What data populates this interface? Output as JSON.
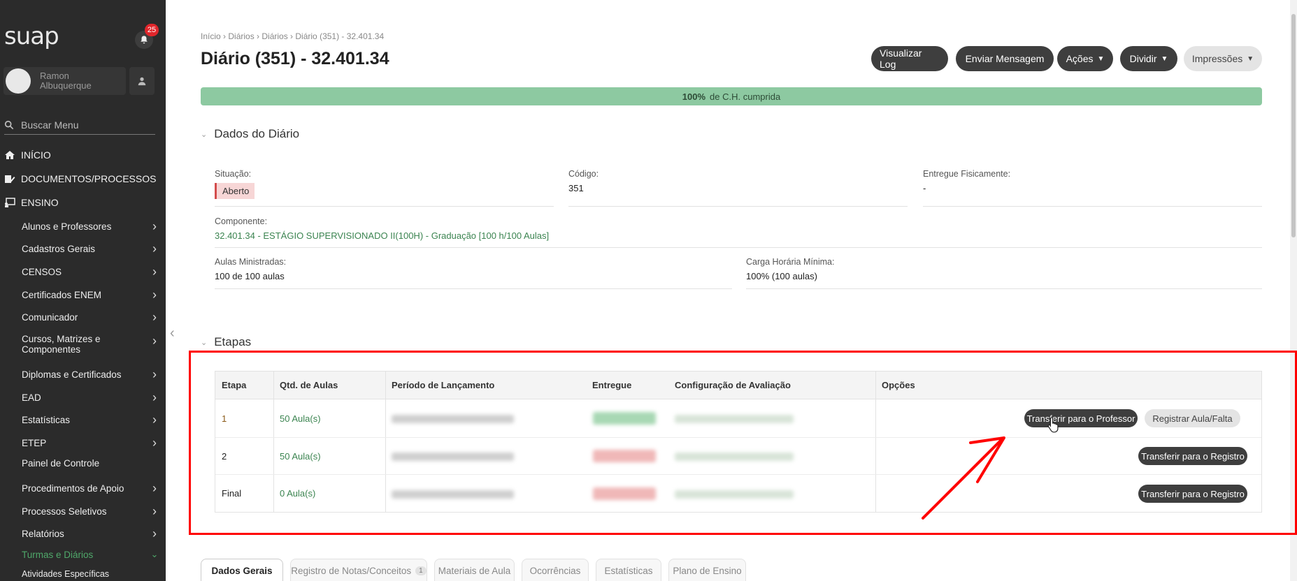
{
  "app": {
    "logo": "suap",
    "notification_count": "25"
  },
  "user": {
    "name": "Ramon Albuquerque"
  },
  "search": {
    "placeholder": "Buscar Menu"
  },
  "nav": {
    "top": [
      {
        "label": "INÍCIO",
        "icon": "home-icon"
      },
      {
        "label": "DOCUMENTOS/PROCESSOS",
        "icon": "document-edit-icon"
      },
      {
        "label": "ENSINO",
        "icon": "classroom-icon"
      }
    ],
    "sub": [
      {
        "label": "Alunos e Professores",
        "has_children": true
      },
      {
        "label": "Cadastros Gerais",
        "has_children": true
      },
      {
        "label": "CENSOS",
        "has_children": true
      },
      {
        "label": "Certificados ENEM",
        "has_children": true
      },
      {
        "label": "Comunicador",
        "has_children": true
      },
      {
        "label": "Cursos, Matrizes e Componentes",
        "has_children": true
      },
      {
        "label": "Diplomas e Certificados",
        "has_children": true
      },
      {
        "label": "EAD",
        "has_children": true
      },
      {
        "label": "Estatísticas",
        "has_children": true
      },
      {
        "label": "ETEP",
        "has_children": true
      },
      {
        "label": "Painel de Controle",
        "has_children": false
      },
      {
        "label": "Procedimentos de Apoio",
        "has_children": true
      },
      {
        "label": "Processos Seletivos",
        "has_children": true
      },
      {
        "label": "Relatórios",
        "has_children": true
      },
      {
        "label": "Turmas e Diários",
        "has_children": true,
        "active": true
      },
      {
        "label": "Atividades Específicas",
        "has_children": false
      }
    ]
  },
  "breadcrumb": {
    "items": [
      "Início",
      "Diários",
      "Diários",
      "Diário (351) - 32.401.34"
    ]
  },
  "page": {
    "title": "Diário (351) - 32.401.34"
  },
  "actions": {
    "log": "Visualizar Log",
    "message": "Enviar Mensagem",
    "acoes": "Ações",
    "dividir": "Dividir",
    "impressoes": "Impressões"
  },
  "progress": {
    "value": "100%",
    "label": "de C.H. cumprida",
    "fraction": 1.0
  },
  "dados": {
    "title": "Dados do Diário",
    "situacao": {
      "label": "Situação:",
      "value": "Aberto"
    },
    "codigo": {
      "label": "Código:",
      "value": "351"
    },
    "entregue": {
      "label": "Entregue Fisicamente:",
      "value": "-"
    },
    "componente": {
      "label": "Componente:",
      "value": "32.401.34 - ESTÁGIO SUPERVISIONADO II(100H) - Graduação [100 h/100 Aulas]"
    },
    "aulas": {
      "label": "Aulas Ministradas:",
      "value": "100 de 100 aulas"
    },
    "carga": {
      "label": "Carga Horária Mínima:",
      "value": "100% (100 aulas)"
    }
  },
  "etapas": {
    "title": "Etapas",
    "headers": [
      "Etapa",
      "Qtd. de Aulas",
      "Período de Lançamento",
      "Entregue",
      "Configuração de Avaliação",
      "Opções"
    ],
    "rows": [
      {
        "etapa": "1",
        "aulas": "50 Aula(s)",
        "options": [
          "Transferir para o Professor",
          "Registrar Aula/Falta"
        ]
      },
      {
        "etapa": "2",
        "aulas": "50 Aula(s)",
        "options": [
          "Transferir para o Registro"
        ]
      },
      {
        "etapa": "Final",
        "aulas": "0 Aula(s)",
        "options": [
          "Transferir para o Registro"
        ]
      }
    ]
  },
  "tabs": [
    {
      "label": "Dados Gerais",
      "active": true
    },
    {
      "label": "Registro de Notas/Conceitos",
      "count": "1"
    },
    {
      "label": "Materiais de Aula"
    },
    {
      "label": "Ocorrências"
    },
    {
      "label": "Estatísticas"
    },
    {
      "label": "Plano de Ensino"
    }
  ],
  "colors": {
    "sidebar_bg": "#2b2b2b",
    "accent_green": "#3b8450",
    "progress_green": "#8dc9a1",
    "annotation_red": "#ff0000"
  }
}
